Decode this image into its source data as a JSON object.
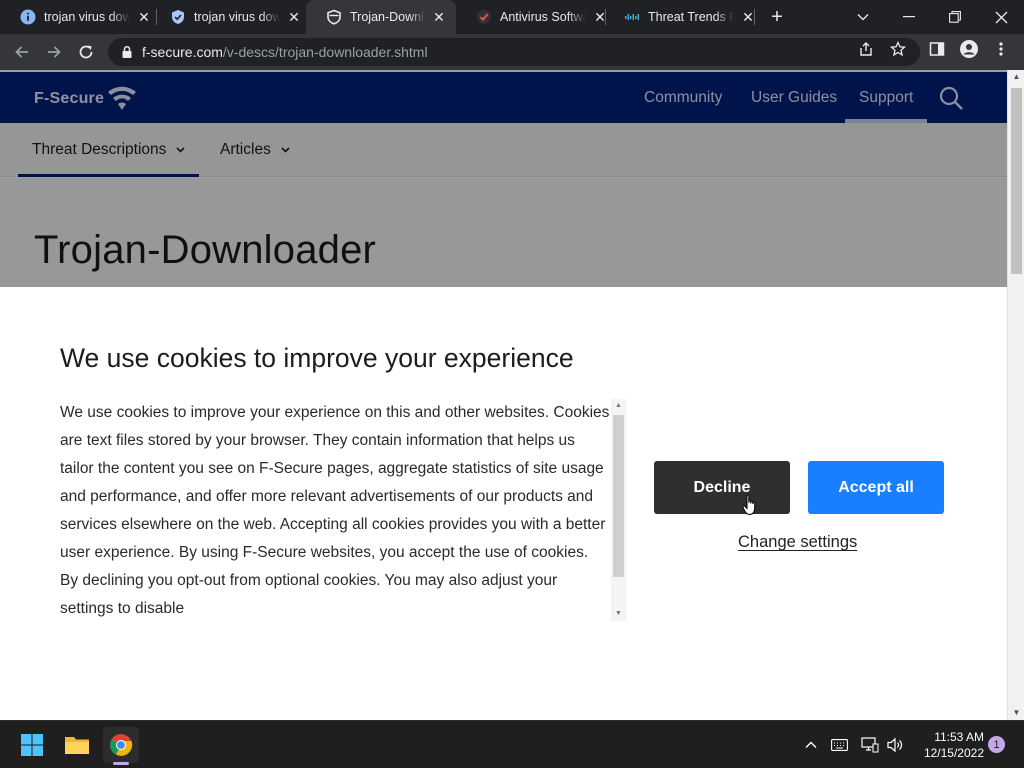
{
  "browser": {
    "tabs": [
      {
        "title": "trojan virus dow",
        "favicon": "info-icon",
        "active": false
      },
      {
        "title": "trojan virus dow",
        "favicon": "shield-check-icon",
        "active": false
      },
      {
        "title": "Trojan-Downloa",
        "favicon": "shield-outline-icon",
        "active": true
      },
      {
        "title": "Antivirus Softwa",
        "favicon": "checkmark-logo-icon",
        "active": false
      },
      {
        "title": "Threat Trends R",
        "favicon": "cisco-logo-icon",
        "active": false
      }
    ],
    "url_domain": "f-secure.com",
    "url_path": "/v-descs/trojan-downloader.shtml"
  },
  "site": {
    "logo_text": "F-Secure",
    "nav": [
      "Community",
      "User Guides",
      "Support"
    ],
    "active_nav": "Support",
    "subnav": [
      {
        "label": "Threat Descriptions",
        "active": true
      },
      {
        "label": "Articles",
        "active": false
      }
    ],
    "page_title": "Trojan-Downloader"
  },
  "cookie_banner": {
    "title": "We use cookies to improve your experience",
    "body": "We use cookies to improve your experience on this and other websites. Cookies are text files stored by your browser. They contain information that helps us tailor the content you see on F-Secure pages, aggregate statistics of site usage and performance, and offer more relevant advertisements of our products and services elsewhere on the web. Accepting all cookies provides you with a better user experience. By using F-Secure websites, you accept the use of cookies. By declining you opt-out from optional cookies. You may also adjust your settings to disable",
    "decline_label": "Decline",
    "accept_label": "Accept all",
    "settings_label": "Change settings"
  },
  "taskbar": {
    "time": "11:53 AM",
    "date": "12/15/2022",
    "notification_count": "1",
    "apps": [
      "windows-start-icon",
      "file-explorer-icon",
      "chrome-icon"
    ]
  },
  "colors": {
    "site_header": "#02207a",
    "accept_button": "#1a7fff",
    "decline_button": "#2f2f2f"
  }
}
